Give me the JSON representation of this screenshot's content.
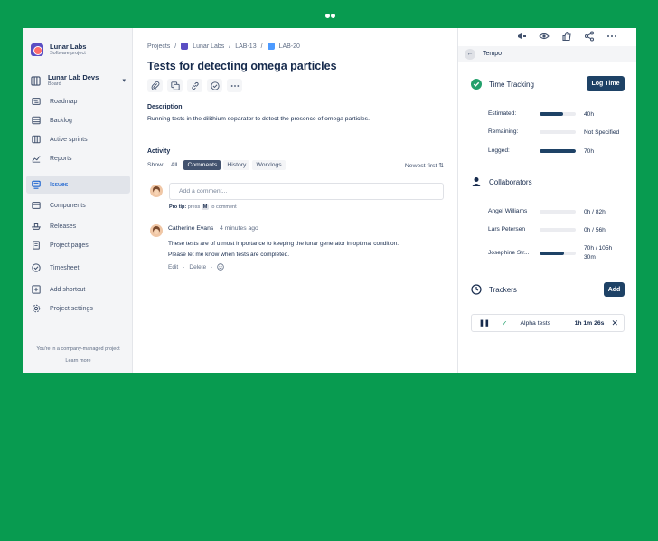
{
  "sidebar": {
    "project_name": "Lunar Labs",
    "project_type": "Software project",
    "board_name": "Lunar Lab Devs",
    "board_sub": "Board",
    "items": [
      {
        "label": "Roadmap"
      },
      {
        "label": "Backlog"
      },
      {
        "label": "Active sprints"
      },
      {
        "label": "Reports"
      },
      {
        "label": "Issues"
      },
      {
        "label": "Components"
      },
      {
        "label": "Releases"
      },
      {
        "label": "Project pages"
      },
      {
        "label": "Timesheet"
      },
      {
        "label": "Add shortcut"
      },
      {
        "label": "Project settings"
      }
    ],
    "footer_text": "You're in a company-managed project",
    "learn_more": "Learn more"
  },
  "breadcrumb": {
    "projects": "Projects",
    "project": "Lunar Labs",
    "parent": "LAB-13",
    "current": "LAB-20"
  },
  "issue": {
    "title": "Tests for detecting omega particles",
    "description_heading": "Description",
    "description": "Running tests in the dilithium separator to detect the presence of omega particles."
  },
  "activity": {
    "heading": "Activity",
    "show_label": "Show:",
    "filters": [
      "All",
      "Comments",
      "History",
      "Worklogs"
    ],
    "sort": "Newest first",
    "comment_placeholder": "Add a comment...",
    "protip_prefix": "Pro tip:",
    "protip_mid": "press",
    "protip_key": "M",
    "protip_suffix": "to comment",
    "comment": {
      "author": "Catherine Evans",
      "time": "4 minutes ago",
      "line1": "These tests are of utmost importance to keeping the lunar generator in optimal condition.",
      "line2": "Please let me know when tests are completed.",
      "edit": "Edit",
      "delete": "Delete"
    }
  },
  "tempo": {
    "bar_title": "Tempo",
    "time_tracking": {
      "title": "Time Tracking",
      "button": "Log Time",
      "rows": [
        {
          "label": "Estimated:",
          "value": "40h",
          "fill": 0.65
        },
        {
          "label": "Remaining:",
          "value": "Not Specified",
          "fill": 0
        },
        {
          "label": "Logged:",
          "value": "70h",
          "fill": 1.0
        }
      ]
    },
    "collaborators": {
      "title": "Collaborators",
      "rows": [
        {
          "label": "Angel Williams",
          "value": "0h / 82h",
          "fill": 0
        },
        {
          "label": "Lars Petersen",
          "value": "0h / 56h",
          "fill": 0
        },
        {
          "label": "Josephine Str...",
          "value": "70h / 105h",
          "value2": "30m",
          "fill": 0.67
        }
      ]
    },
    "trackers": {
      "title": "Trackers",
      "button": "Add",
      "item": {
        "name": "Alpha tests",
        "time": "1h 1m 26s"
      }
    }
  },
  "colors": {
    "background": "#089b50",
    "accent_dark": "#1e4266",
    "link_blue": "#0052cc",
    "success_green": "#22a06b"
  }
}
